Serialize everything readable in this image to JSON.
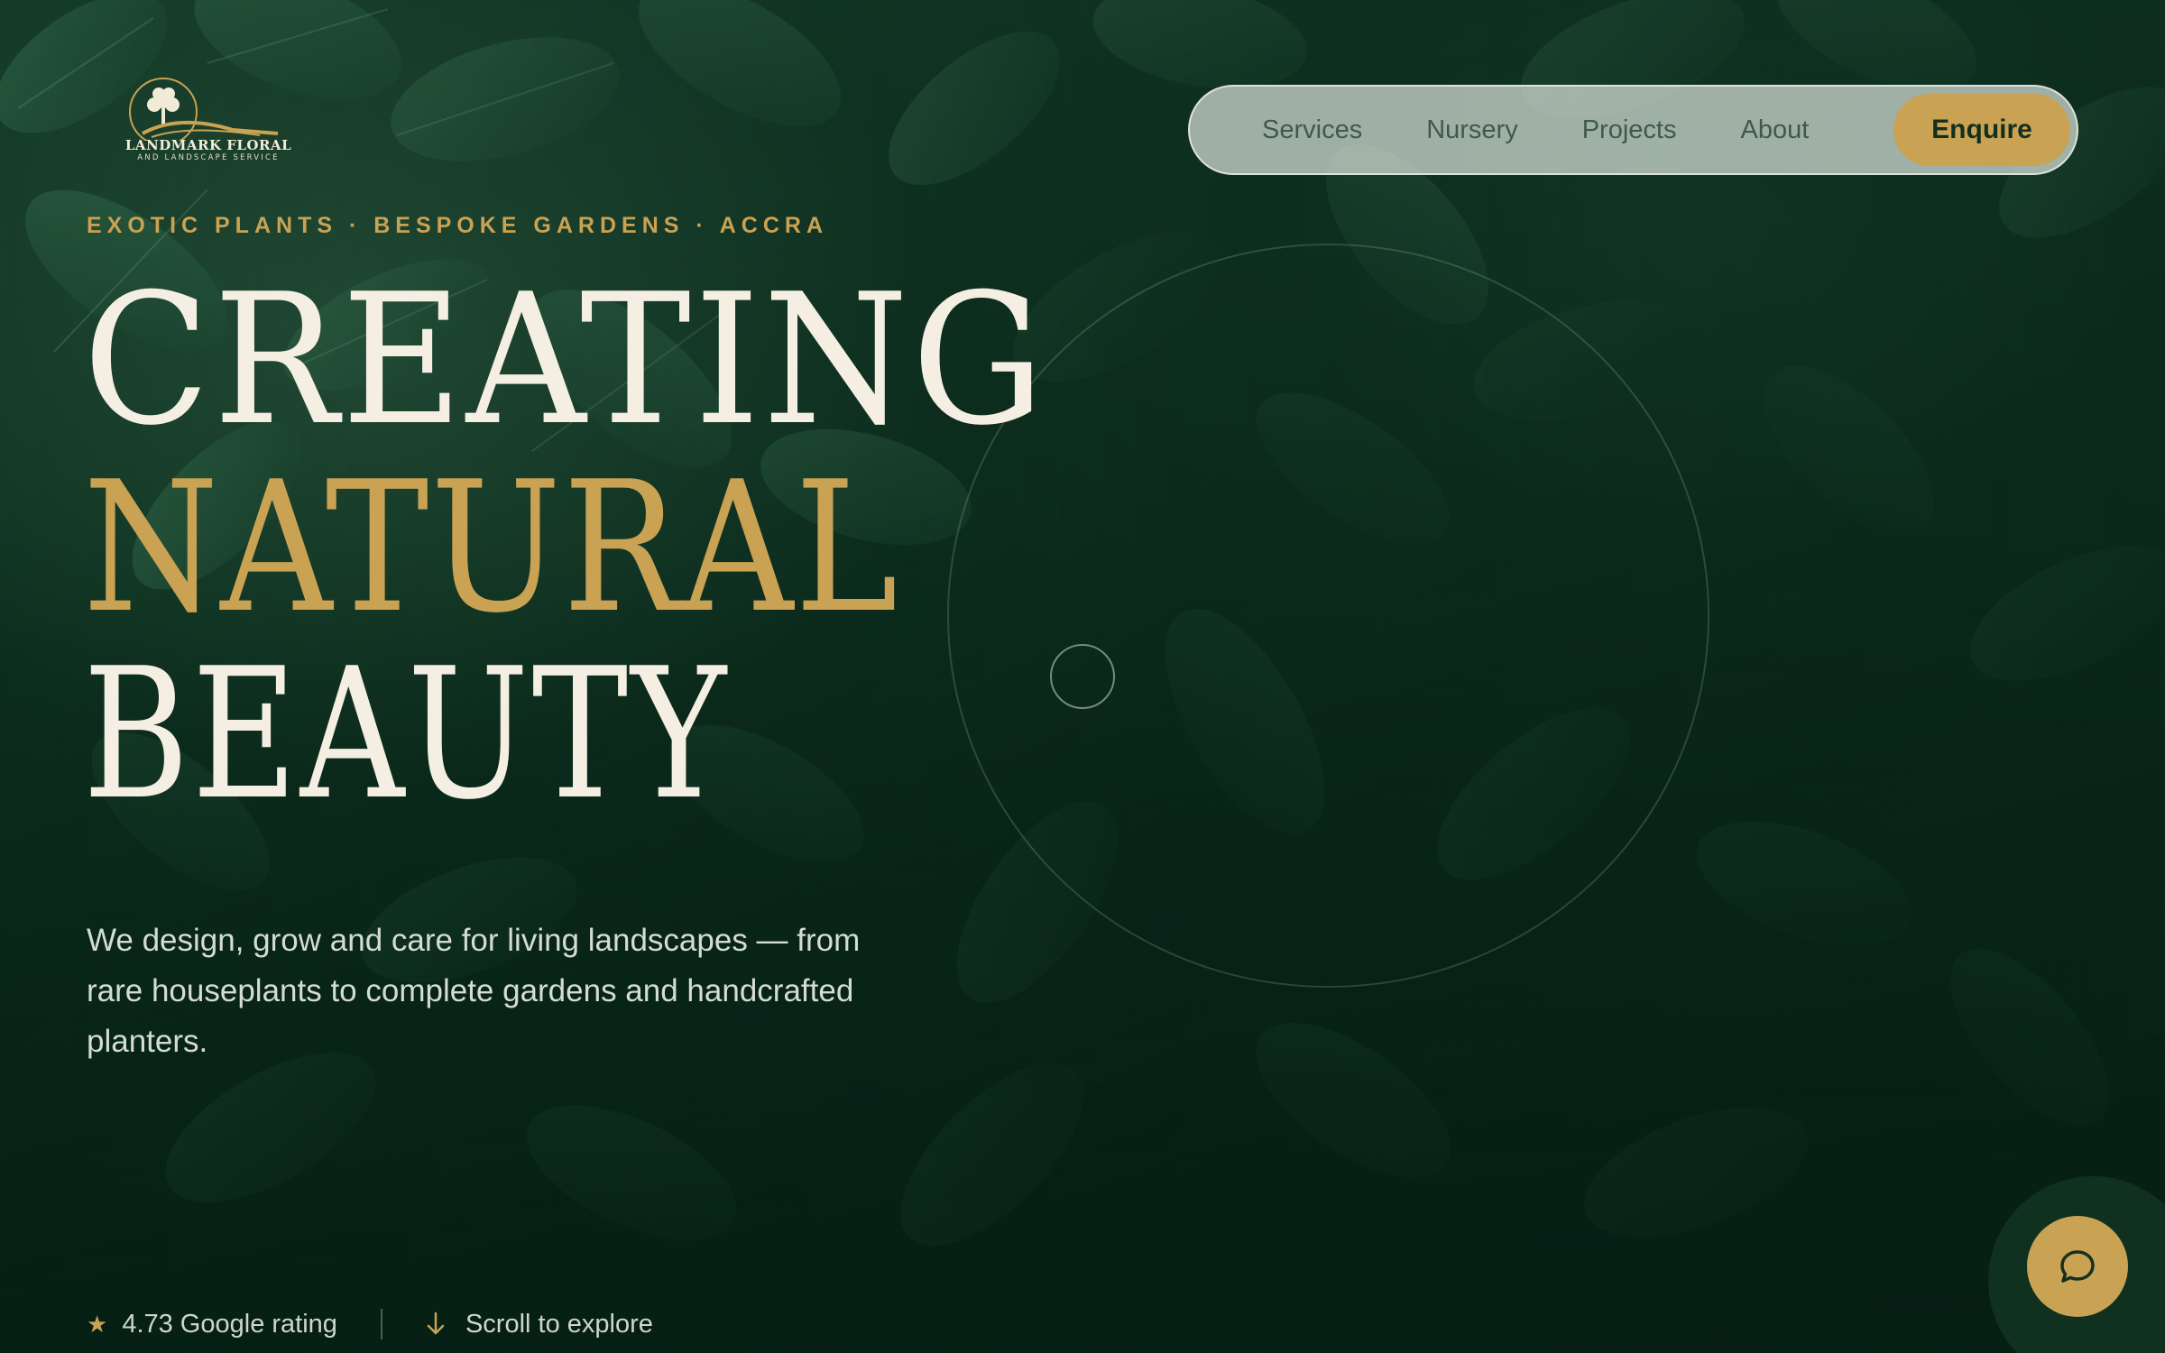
{
  "brand": {
    "name": "LANDMARK FLORAL",
    "tagline": "AND LANDSCAPE SERVICE"
  },
  "nav": {
    "items": [
      {
        "label": "Services"
      },
      {
        "label": "Nursery"
      },
      {
        "label": "Projects"
      },
      {
        "label": "About"
      }
    ],
    "cta_label": "Enquire"
  },
  "hero": {
    "eyebrow": "EXOTIC PLANTS · BESPOKE GARDENS · ACCRA",
    "headline": {
      "line1": "CREATING",
      "line2": "NATURAL",
      "line3": "BEAUTY"
    },
    "lede": "We design, grow and care for living landscapes — from rare houseplants to complete gardens and handcrafted planters."
  },
  "footer": {
    "rating_text": "4.73 Google rating",
    "scroll_text": "Scroll to explore"
  },
  "icons": {
    "rating": "star-icon",
    "scroll": "arrow-down-icon",
    "chat": "chat-bubble-icon",
    "logo": "tree-logo-icon"
  },
  "colors": {
    "accent": "#c9a253",
    "background": "#0f3322",
    "headline": "#f4efe2",
    "nav_bg": "#dae2da"
  }
}
